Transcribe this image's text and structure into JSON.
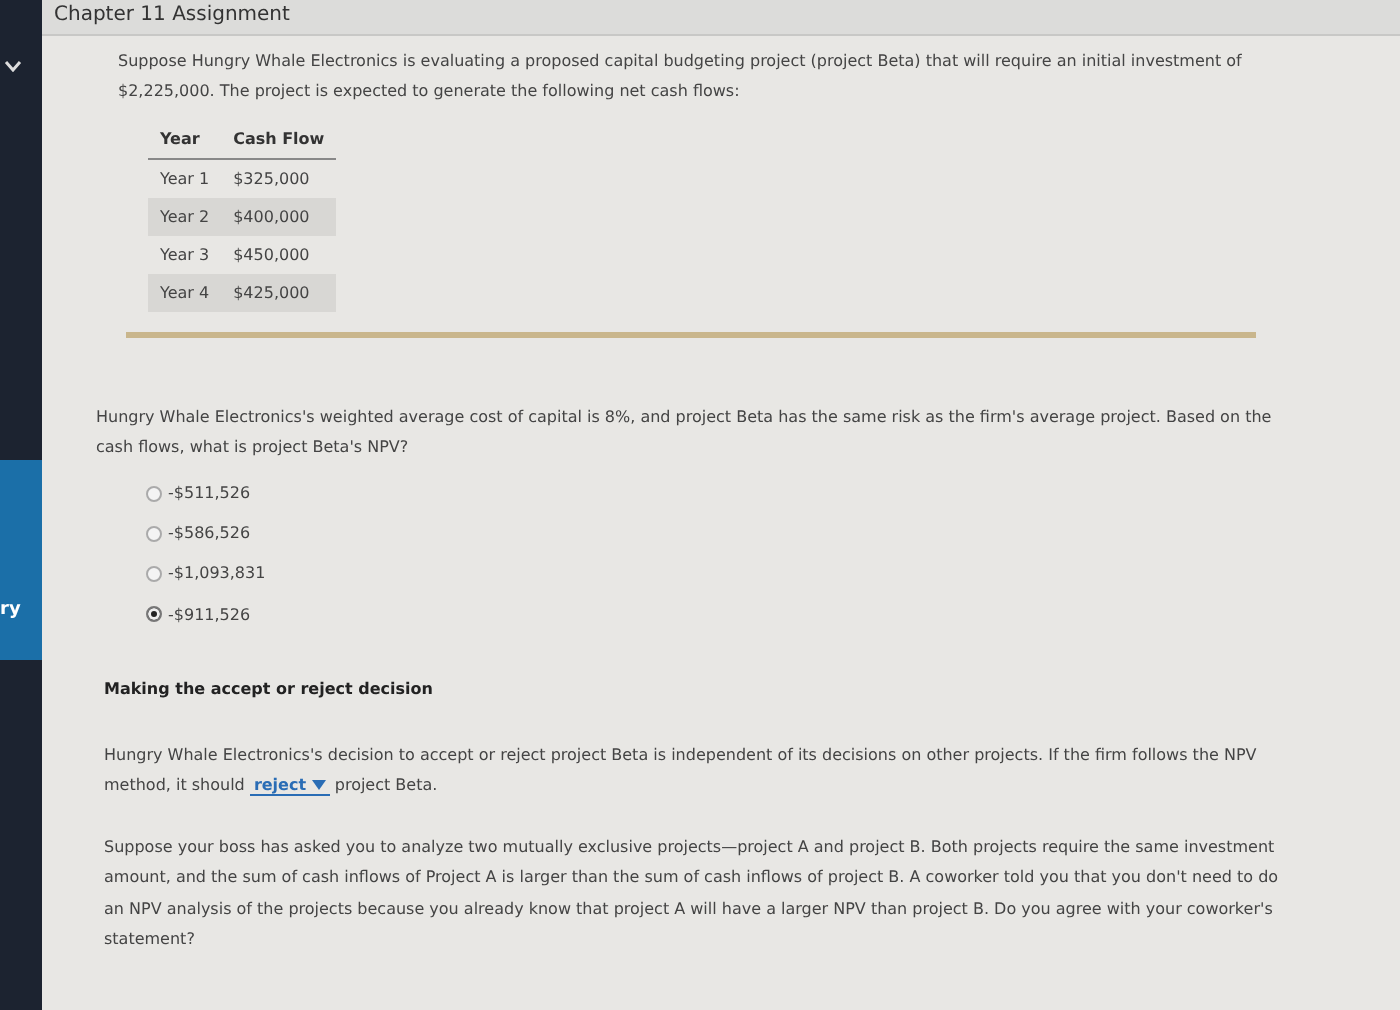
{
  "header": {
    "title": "Chapter 11 Assignment"
  },
  "sidebar": {
    "label": "ry"
  },
  "intro": "Suppose Hungry Whale Electronics is evaluating a proposed capital budgeting project (project Beta) that will require an initial investment of $2,225,000. The project is expected to generate the following net cash flows:",
  "table": {
    "columns": [
      "Year",
      "Cash Flow"
    ],
    "rows": [
      [
        "Year 1",
        "$325,000"
      ],
      [
        "Year 2",
        "$400,000"
      ],
      [
        "Year 3",
        "$450,000"
      ],
      [
        "Year 4",
        "$425,000"
      ]
    ]
  },
  "question": "Hungry Whale Electronics's weighted average cost of capital is 8%, and project Beta has the same risk as the firm's average project. Based on the cash flows, what is project Beta's NPV?",
  "options": [
    {
      "label": "-$511,526",
      "selected": false
    },
    {
      "label": "-$586,526",
      "selected": false
    },
    {
      "label": "-$1,093,831",
      "selected": false
    },
    {
      "label": "-$911,526",
      "selected": true
    }
  ],
  "section_heading": "Making the accept or reject decision",
  "decision": {
    "before": "Hungry Whale Electronics's decision to accept or reject project Beta is independent of its decisions on other projects. If the firm follows the NPV method, it should",
    "dropdown": "reject",
    "after": "project Beta."
  },
  "final_question": "Suppose your boss has asked you to analyze two mutually exclusive projects—project A and project B. Both projects require the same investment amount, and the sum of cash inflows of Project A is larger than the sum of cash inflows of project B. A coworker told you that you don't need to do an NPV analysis of the projects because you already know that project A will have a larger NPV than project B. Do you agree with your coworker's statement?"
}
